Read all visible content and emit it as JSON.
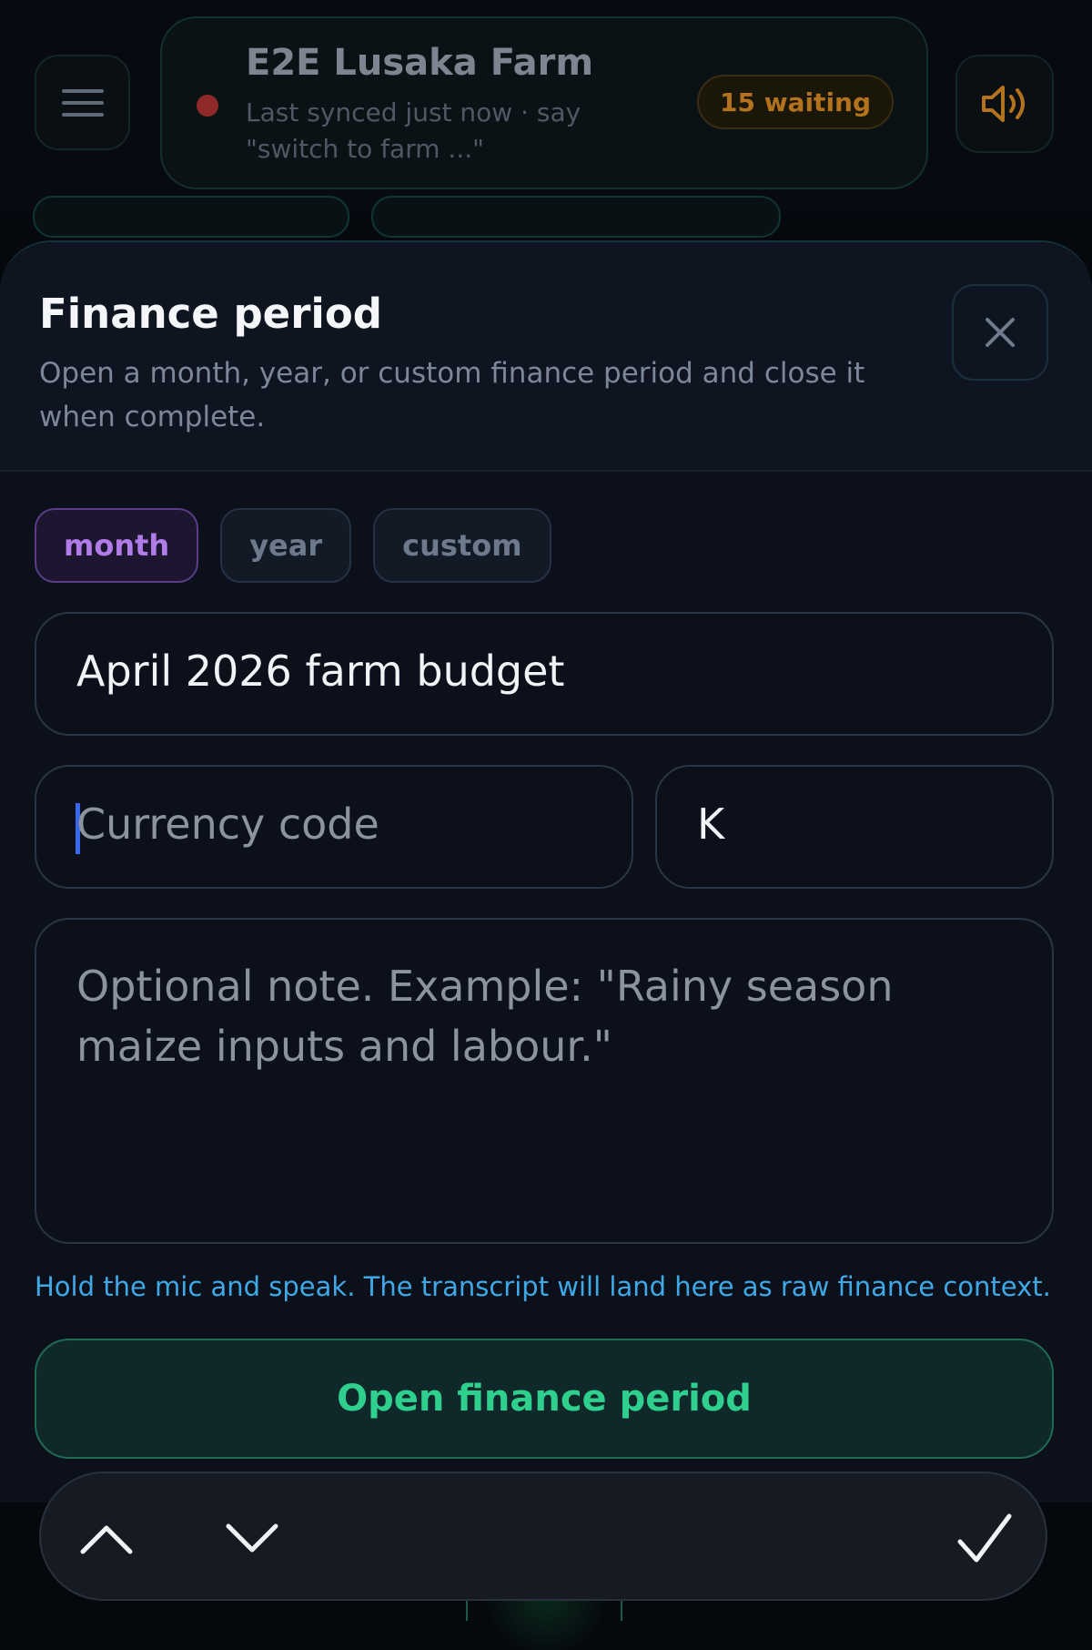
{
  "header": {
    "farm_name": "E2E Lusaka Farm",
    "sync_status": "Last synced just now · say \"switch to farm ...\"",
    "waiting_badge": "15 waiting",
    "status_color": "#8e2a2a"
  },
  "sheet": {
    "title": "Finance period",
    "description": "Open a month, year, or custom finance period and close it when complete.",
    "period_types": [
      {
        "label": "month",
        "selected": true
      },
      {
        "label": "year",
        "selected": false
      },
      {
        "label": "custom",
        "selected": false
      }
    ],
    "name_field": {
      "value": "April 2026 farm budget"
    },
    "currency_field": {
      "value": "",
      "placeholder": "Currency code"
    },
    "symbol_field": {
      "value": "K"
    },
    "note_field": {
      "value": "",
      "placeholder": "Optional note. Example: \"Rainy season maize inputs and labour.\""
    },
    "mic_hint": "Hold the mic and speak. The transcript will land here as raw finance context.",
    "submit_label": "Open finance period"
  },
  "icons": {
    "menu": "menu-icon",
    "sound": "speaker-icon",
    "close": "close-icon",
    "prev": "chevron-up-icon",
    "next": "chevron-down-icon",
    "done": "checkmark-icon"
  },
  "colors": {
    "accent_purple": "#b07ce8",
    "accent_green": "#2fd08e",
    "hint_blue": "#3ea9e6",
    "warning_orange": "#b3731e"
  }
}
